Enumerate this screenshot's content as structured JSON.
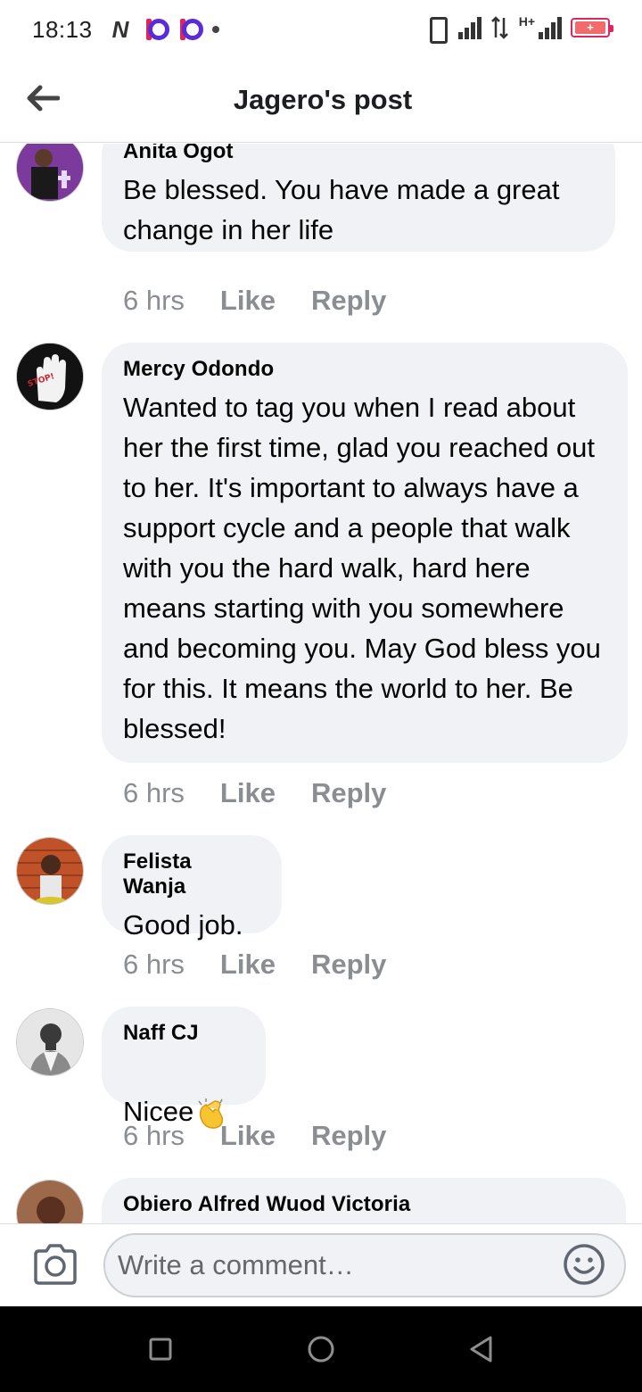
{
  "status_bar": {
    "time": "18:13",
    "network_label": "H+",
    "battery_symbol": "+"
  },
  "header": {
    "title": "Jagero's post"
  },
  "comments": [
    {
      "author": "Anita Ogot",
      "text": "Be blessed. You have made a great change in her life",
      "time": "6 hrs",
      "like": "Like",
      "reply": "Reply"
    },
    {
      "author": "Mercy Odondo",
      "text": "Wanted to tag you when I read about her the first time, glad you reached out to her. It's important to always have a support cycle and a people that walk with you the hard walk, hard here means starting with you somewhere and becoming you. May God bless you for this. It means the world to her. Be blessed!",
      "time": "6 hrs",
      "like": "Like",
      "reply": "Reply",
      "avatar_text": "STOP!"
    },
    {
      "author": "Felista Wanja",
      "text": "Good job.",
      "time": "6 hrs",
      "like": "Like",
      "reply": "Reply"
    },
    {
      "author": "Naff CJ",
      "text": "Nicee",
      "emoji": "clapping-hands",
      "time": "6 hrs",
      "like": "Like",
      "reply": "Reply"
    },
    {
      "author": "Obiero Alfred Wuod Victoria"
    }
  ],
  "composer": {
    "placeholder": "Write a comment…"
  },
  "colors": {
    "bubble": "#f0f2f5",
    "meta_text": "#8a8d91",
    "divider": "#dadde1"
  }
}
